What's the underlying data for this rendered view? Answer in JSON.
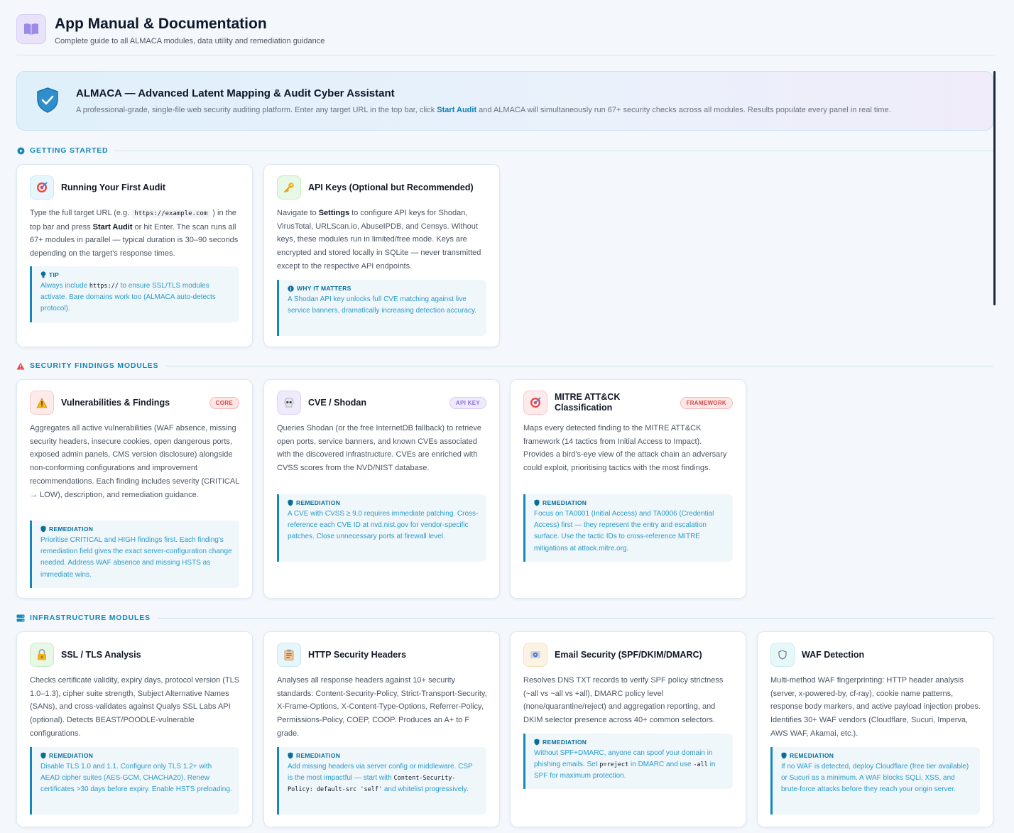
{
  "header": {
    "title": "App Manual & Documentation",
    "subtitle": "Complete guide to all ALMACA modules, data utility and remediation guidance"
  },
  "hero": {
    "title": "ALMACA — Advanced Latent Mapping & Audit Cyber Assistant",
    "desc_before": "A professional-grade, single-file web security auditing platform. Enter any target URL in the top bar, click ",
    "desc_bold": "Start Audit",
    "desc_after": " and ALMACA will simultaneously run 67+ security checks across all modules. Results populate every panel in real time."
  },
  "sections": {
    "getting_started": "GETTING STARTED",
    "security_findings": "SECURITY FINDINGS MODULES",
    "infrastructure": "INFRASTRUCTURE MODULES"
  },
  "cards": {
    "first_audit": {
      "title": "Running Your First Audit",
      "d1": "Type the full target URL (e.g. ",
      "d_code": "https://example.com",
      "d2": " ) in the top bar and press ",
      "d_bold": "Start Audit",
      "d3": " or hit Enter. The scan runs all 67+ modules in parallel — typical duration is 30–90 seconds depending on the target's response times.",
      "note_label": "TIP",
      "n1": "Always include ",
      "n_code": "https://",
      "n2": " to ensure SSL/TLS modules activate. Bare domains work too (ALMACA auto-detects protocol)."
    },
    "api_keys": {
      "title": "API Keys (Optional but Recommended)",
      "d1": "Navigate to ",
      "d_bold": "Settings",
      "d2": " to configure API keys for Shodan, VirusTotal, URLScan.io, AbuseIPDB, and Censys. Without keys, these modules run in limited/free mode. Keys are encrypted and stored locally in SQLite — never transmitted except to the respective API endpoints.",
      "note_label": "WHY IT MATTERS",
      "note_text": "A Shodan API key unlocks full CVE matching against live service banners, dramatically increasing detection accuracy."
    },
    "vulns": {
      "title": "Vulnerabilities & Findings",
      "badge": "CORE",
      "desc": "Aggregates all active vulnerabilities (WAF absence, missing security headers, insecure cookies, open dangerous ports, exposed admin panels, CMS version disclosure) alongside non-conforming configurations and improvement recommendations. Each finding includes severity (CRITICAL → LOW), description, and remediation guidance.",
      "note_label": "REMEDIATION",
      "note_text": "Prioritise CRITICAL and HIGH findings first. Each finding's remediation field gives the exact server-configuration change needed. Address WAF absence and missing HSTS as immediate wins."
    },
    "cve": {
      "title": "CVE / Shodan",
      "badge": "API KEY",
      "desc": "Queries Shodan (or the free InternetDB fallback) to retrieve open ports, service banners, and known CVEs associated with the discovered infrastructure. CVEs are enriched with CVSS scores from the NVD/NIST database.",
      "note_label": "REMEDIATION",
      "note_text": "A CVE with CVSS ≥ 9.0 requires immediate patching. Cross-reference each CVE ID at nvd.nist.gov for vendor-specific patches. Close unnecessary ports at firewall level."
    },
    "mitre": {
      "title": "MITRE ATT&CK Classification",
      "badge": "FRAMEWORK",
      "desc": "Maps every detected finding to the MITRE ATT&CK framework (14 tactics from Initial Access to Impact). Provides a bird's-eye view of the attack chain an adversary could exploit, prioritising tactics with the most findings.",
      "note_label": "REMEDIATION",
      "note_text": "Focus on TA0001 (Initial Access) and TA0006 (Credential Access) first — they represent the entry and escalation surface. Use the tactic IDs to cross-reference MITRE mitigations at attack.mitre.org."
    },
    "ssl": {
      "title": "SSL / TLS Analysis",
      "desc": "Checks certificate validity, expiry days, protocol version (TLS 1.0–1.3), cipher suite strength, Subject Alternative Names (SANs), and cross-validates against Qualys SSL Labs API (optional). Detects BEAST/POODLE-vulnerable configurations.",
      "note_label": "REMEDIATION",
      "note_text": "Disable TLS 1.0 and 1.1. Configure only TLS 1.2+ with AEAD cipher suites (AES-GCM, CHACHA20). Renew certificates >30 days before expiry. Enable HSTS preloading."
    },
    "http": {
      "title": "HTTP Security Headers",
      "desc": "Analyses all response headers against 10+ security standards: Content-Security-Policy, Strict-Transport-Security, X-Frame-Options, X-Content-Type-Options, Referrer-Policy, Permissions-Policy, COEP, COOP. Produces an A+ to F grade.",
      "note_label": "REMEDIATION",
      "n1": "Add missing headers via server config or middleware. CSP is the most impactful — start with ",
      "n_code": "Content-Security-Policy: default-src 'self'",
      "n2": " and whitelist progressively."
    },
    "email": {
      "title": "Email Security (SPF/DKIM/DMARC)",
      "desc": "Resolves DNS TXT records to verify SPF policy strictness (~all vs ~all vs +all), DMARC policy level (none/quarantine/reject) and aggregation reporting, and DKIM selector presence across 40+ common selectors.",
      "note_label": "REMEDIATION",
      "n1": "Without SPF+DMARC, anyone can spoof your domain in phishing emails. Set ",
      "n_code1": "p=reject",
      "n2": " in DMARC and use ",
      "n_code2": "-all",
      "n3": " in SPF for maximum protection."
    },
    "waf": {
      "title": "WAF Detection",
      "desc": "Multi-method WAF fingerprinting: HTTP header analysis (server, x-powered-by, cf-ray), cookie name patterns, response body markers, and active payload injection probes. Identifies 30+ WAF vendors (Cloudflare, Sucuri, Imperva, AWS WAF, Akamai, etc.).",
      "note_label": "REMEDIATION",
      "note_text": "If no WAF is detected, deploy Cloudflare (free tier available) or Sucuri as a minimum. A WAF blocks SQLi, XSS, and brute-force attacks before they reach your origin server."
    }
  }
}
